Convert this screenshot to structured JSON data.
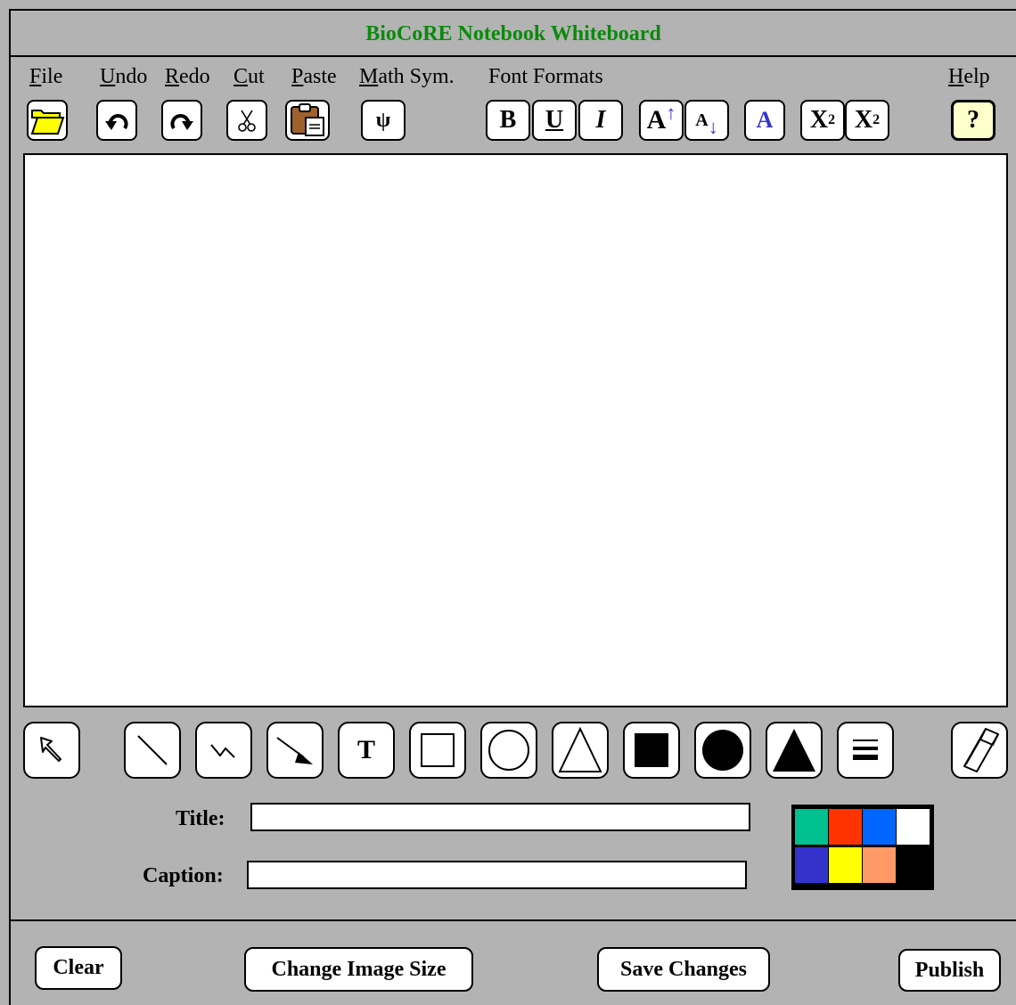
{
  "app": {
    "title": "BioCoRE Notebook Whiteboard"
  },
  "menu": [
    {
      "label": "File",
      "accel": "F",
      "rest": "ile"
    },
    {
      "label": "Undo",
      "accel": "U",
      "rest": "ndo"
    },
    {
      "label": "Redo",
      "accel": "R",
      "rest": "edo"
    },
    {
      "label": "Cut",
      "accel": "C",
      "rest": "ut"
    },
    {
      "label": "Paste",
      "accel": "P",
      "rest": "aste"
    },
    {
      "label": "Math Sym.",
      "accel": "M",
      "rest": "ath Sym."
    },
    {
      "label": "Font Formats",
      "accel": "",
      "rest": "Font Formats"
    },
    {
      "label": "Help",
      "accel": "H",
      "rest": "elp"
    }
  ],
  "toolbar": {
    "open_icon": "folder-open-icon",
    "undo_icon": "undo-arrow-icon",
    "redo_icon": "redo-arrow-icon",
    "cut_icon": "scissors-icon",
    "paste_icon": "clipboard-paste-icon",
    "math_symbol": "ψ",
    "bold": "B",
    "underline": "U",
    "italic": "I",
    "font_larger": "A",
    "font_smaller": "A",
    "font_color": "A",
    "superscript_base": "X",
    "superscript_exp": "2",
    "subscript_base": "X",
    "subscript_exp": "2",
    "help": "?"
  },
  "tools": [
    {
      "name": "select-tool",
      "icon": "pointer-arrow-icon"
    },
    {
      "name": "line-tool",
      "icon": "line-icon"
    },
    {
      "name": "freehand-tool",
      "icon": "squiggle-icon"
    },
    {
      "name": "arrow-tool",
      "icon": "arrow-icon"
    },
    {
      "name": "text-tool",
      "icon": "text-icon",
      "label": "T"
    },
    {
      "name": "rectangle-tool",
      "icon": "rectangle-outline-icon"
    },
    {
      "name": "ellipse-tool",
      "icon": "circle-outline-icon"
    },
    {
      "name": "triangle-tool",
      "icon": "triangle-outline-icon"
    },
    {
      "name": "filled-rectangle-tool",
      "icon": "rectangle-filled-icon"
    },
    {
      "name": "filled-ellipse-tool",
      "icon": "circle-filled-icon"
    },
    {
      "name": "filled-triangle-tool",
      "icon": "triangle-filled-icon"
    },
    {
      "name": "line-width-tool",
      "icon": "line-width-icon"
    },
    {
      "name": "eraser-tool",
      "icon": "eraser-icon"
    }
  ],
  "form": {
    "title_label": "Title:",
    "title_value": "",
    "caption_label": "Caption:",
    "caption_value": ""
  },
  "palette": {
    "colors": [
      "#00c08f",
      "#ff3300",
      "#0066ff",
      "#ffffff",
      "#3333cc",
      "#ffff00",
      "#ff9966",
      "#000000"
    ]
  },
  "buttons": {
    "clear": "Clear",
    "change_size": "Change Image Size",
    "save": "Save Changes",
    "publish": "Publish"
  },
  "colors": {
    "title_green": "#0b8a0b",
    "background": "#b3b3b3",
    "folder_yellow": "#ffff00",
    "help_bg": "#ffffcc",
    "accent_blue": "#3333cc"
  }
}
